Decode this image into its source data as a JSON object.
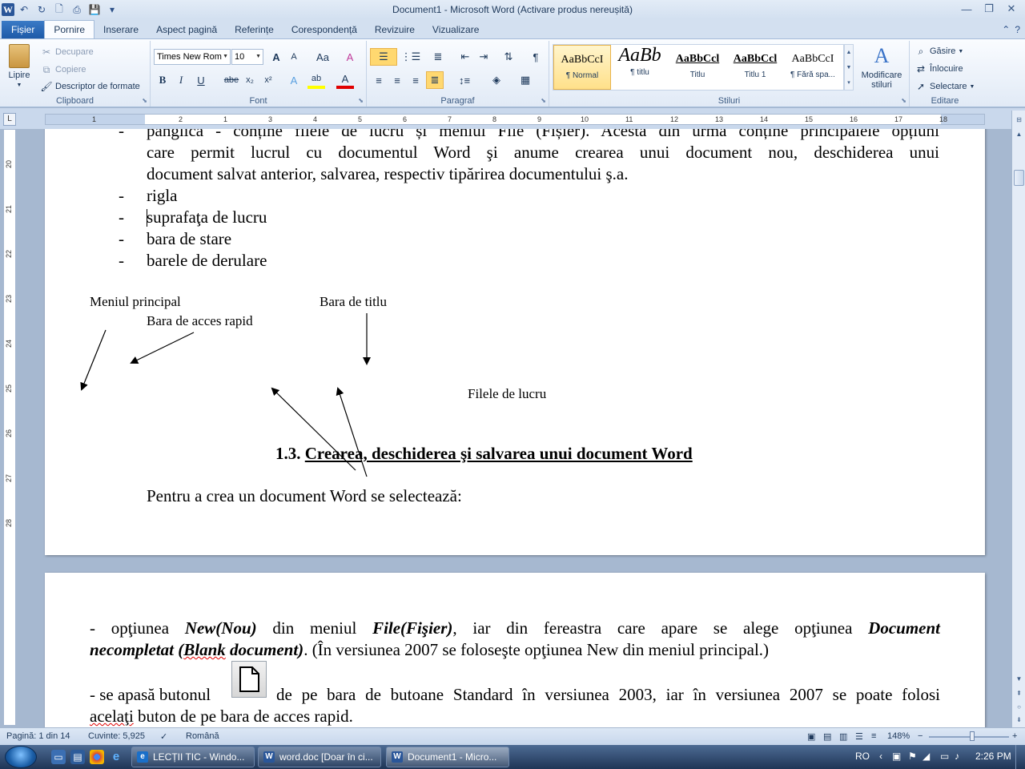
{
  "window": {
    "title": "Document1 - Microsoft Word (Activare produs nereușită)",
    "minimize": "—",
    "restore": "❐",
    "close": "✕"
  },
  "qat": {
    "app_icon": "W",
    "undo": "↶",
    "redo": "↻",
    "new": "🗋",
    "print": "⎙",
    "save": "💾",
    "customize": "▾"
  },
  "tabs": [
    {
      "label": "Fișier"
    },
    {
      "label": "Pornire"
    },
    {
      "label": "Inserare"
    },
    {
      "label": "Aspect pagină"
    },
    {
      "label": "Referințe"
    },
    {
      "label": "Corespondență"
    },
    {
      "label": "Revizuire"
    },
    {
      "label": "Vizualizare"
    }
  ],
  "ribbon": {
    "clipboard": {
      "label": "Clipboard",
      "paste": "Lipire",
      "cut": "Decupare",
      "copy": "Copiere",
      "format_painter": "Descriptor de formate"
    },
    "font": {
      "label": "Font",
      "font_name": "Times New Rom",
      "font_size": "10",
      "grow": "A",
      "shrink": "A",
      "change_case": "Aa",
      "clear": "A",
      "bold": "B",
      "italic": "I",
      "underline": "U",
      "strike": "abe",
      "sub": "x₂",
      "sup": "x²",
      "effects": "A",
      "highlight": "ab",
      "color": "A"
    },
    "paragraph": {
      "label": "Paragraf",
      "pilcrow": "¶"
    },
    "styles": {
      "label": "Stiluri",
      "items": [
        {
          "preview": "AaBbCcI",
          "name": "¶ Normal"
        },
        {
          "preview": "AaBb",
          "name": "¶ titlu"
        },
        {
          "preview": "AaBbCcl",
          "name": "Titlu"
        },
        {
          "preview": "AaBbCcl",
          "name": "Titlu 1"
        },
        {
          "preview": "AaBbCcI",
          "name": "¶ Fără spa..."
        }
      ],
      "change_styles": "Modificare stiluri"
    },
    "editing": {
      "label": "Editare",
      "find": "Găsire",
      "replace": "Înlocuire",
      "select": "Selectare"
    }
  },
  "ruler": {
    "h_numbers": [
      "1",
      "1",
      "2",
      "3",
      "4",
      "5",
      "6",
      "7",
      "8",
      "9",
      "10",
      "11",
      "12",
      "13",
      "14",
      "15",
      "16",
      "17",
      "18"
    ],
    "v_numbers": [
      "20",
      "21",
      "22",
      "23",
      "24",
      "25",
      "26",
      "27",
      "28"
    ]
  },
  "document": {
    "page1": {
      "bullet_char": "-",
      "para1_line1": "panglica  - conține filele de lucru și meniul File (Fișier). Acesta din urmă conține principalele opțiuni",
      "para1_line2": "care permit lucrul cu documentul Word şi anume crearea unui document nou, deschiderea unui",
      "para1_line3": "document salvat anterior, salvarea, respectiv tipărirea documentului ş.a.",
      "bullets": [
        "rigla",
        "suprafaţa de lucru",
        "bara de stare",
        "barele de derulare"
      ],
      "annotations": {
        "main_menu": "Meniul principal",
        "title_bar": "Bara de titlu",
        "quick_access": "Bara de acces rapid",
        "tabs": "Filele de lucru"
      },
      "heading_number": "1.3.",
      "heading_text": "Crearea, deschiderea şi salvarea unui document Word",
      "intro": "Pentru a crea un document Word se selectează:"
    },
    "page2": {
      "p1_a": "- opţiunea ",
      "p1_b": "New(Nou)",
      "p1_c": " din meniul ",
      "p1_d": "File(Fişier)",
      "p1_e": ", iar din fereastra care apare se alege opţiunea ",
      "p1_f": "Document",
      "p1_line2_a": "necompletat (",
      "p1_line2_b": "Blank",
      "p1_line2_c": " document)",
      "p1_line2_d": ". (În versiunea 2007 se foloseşte opţiunea New din meniul principal.)",
      "p2_a": "- se apasă butonul",
      "p2_b": "de pe bara de butoane Standard în versiunea 2003, iar în versiunea 2007 se poate folosi",
      "p2_line2_a": "acelaţi",
      "p2_line2_b": " buton de pe bara de acces rapid."
    }
  },
  "statusbar": {
    "page": "Pagină: 1 din 14",
    "words": "Cuvinte: 5,925",
    "language": "Română",
    "zoom": "148%",
    "zoom_out": "−",
    "zoom_in": "+"
  },
  "taskbar": {
    "tasks": [
      {
        "label": "LECȚII TIC - Windo..."
      },
      {
        "label": "word.doc [Doar în ci..."
      },
      {
        "label": "Document1 - Micro..."
      }
    ],
    "lang": "RO",
    "time": "2:26 PM"
  },
  "colors": {
    "accent": "#2a5699",
    "file_tab": "#1d5aa8",
    "selected_style": "#ffe08a",
    "spell_error": "#e00000"
  }
}
